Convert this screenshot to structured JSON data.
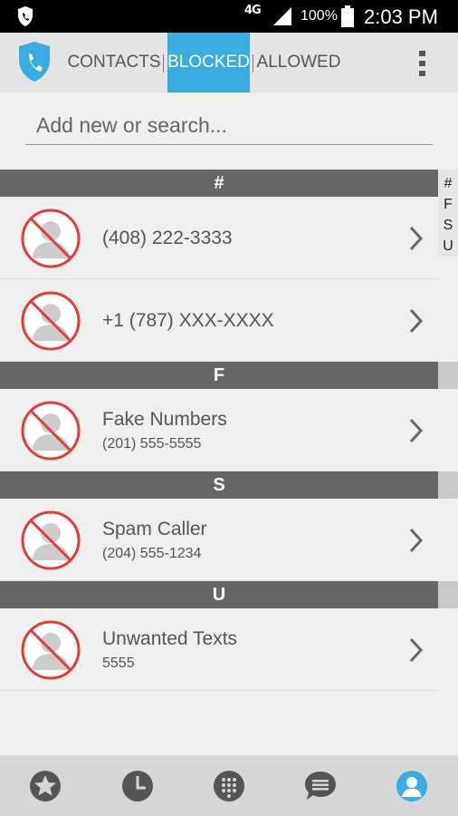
{
  "status_bar": {
    "network": "4G",
    "battery_percent": "100%",
    "time": "2:03 PM"
  },
  "top_bar": {
    "tabs": [
      {
        "label": "CONTACTS",
        "active": false
      },
      {
        "label": "BLOCKED",
        "active": true
      },
      {
        "label": "ALLOWED",
        "active": false
      }
    ],
    "accent_color": "#3aace0"
  },
  "search": {
    "placeholder": "Add new or search...",
    "value": ""
  },
  "sections": [
    {
      "header": "#",
      "rows": [
        {
          "name": "(408) 222-3333",
          "number": ""
        },
        {
          "name": "+1 (787) XXX-XXXX",
          "number": ""
        }
      ]
    },
    {
      "header": "F",
      "rows": [
        {
          "name": "Fake Numbers",
          "number": "(201) 555-5555"
        }
      ]
    },
    {
      "header": "S",
      "rows": [
        {
          "name": "Spam Caller",
          "number": "(204) 555-1234"
        }
      ]
    },
    {
      "header": "U",
      "rows": [
        {
          "name": "Unwanted Texts",
          "number": "5555"
        }
      ]
    }
  ],
  "alpha_index": [
    "#",
    "F",
    "S",
    "U"
  ],
  "bottom_nav": {
    "items": [
      "favorites-icon",
      "recent-calls-icon",
      "dialpad-icon",
      "messages-icon",
      "contacts-icon"
    ],
    "active_color": "#3aace0"
  }
}
